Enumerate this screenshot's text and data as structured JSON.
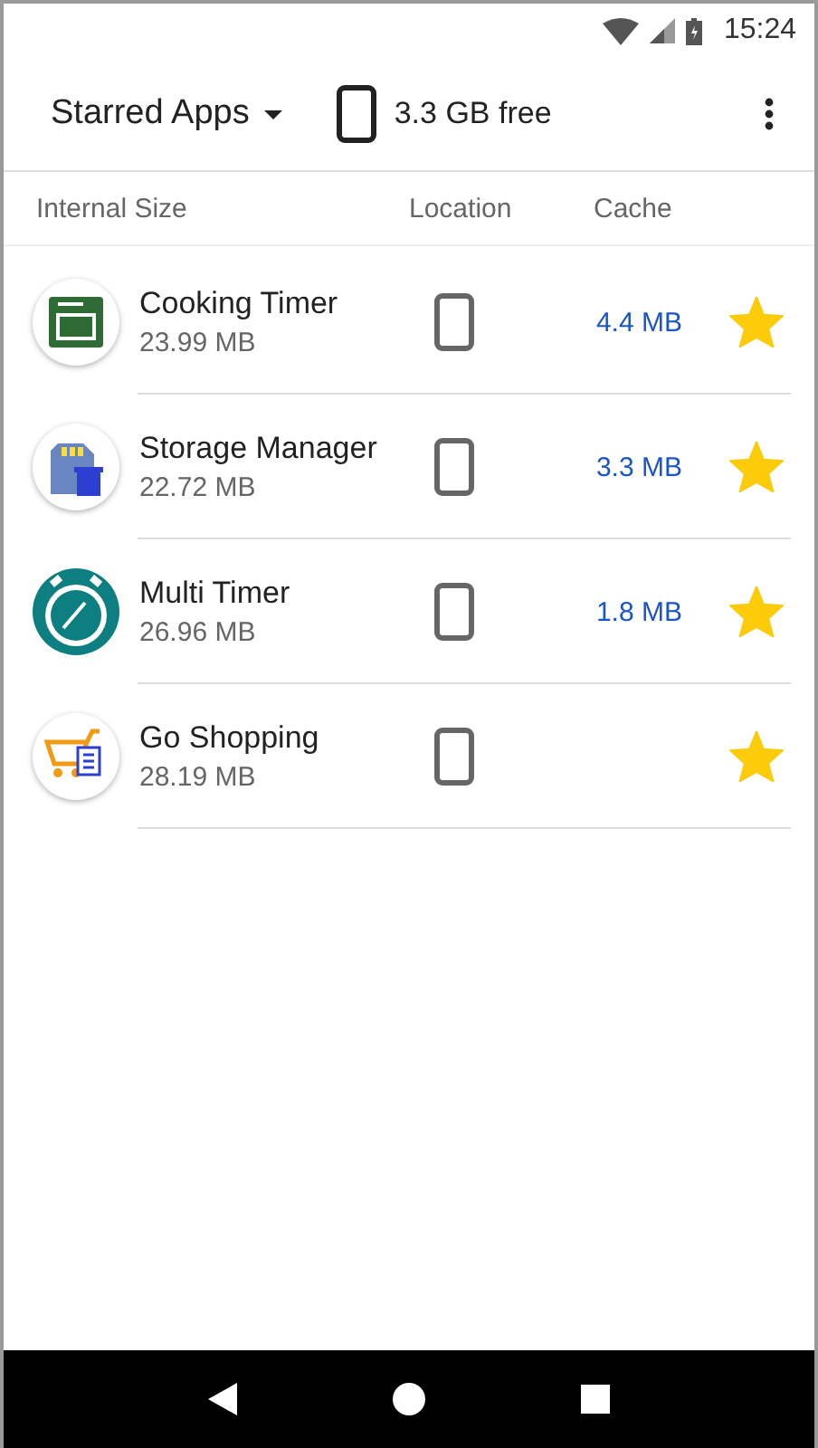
{
  "status_bar": {
    "time": "15:24"
  },
  "toolbar": {
    "filter": "Starred Apps",
    "storage": "3.3 GB free"
  },
  "columns": [
    "Internal Size",
    "Location",
    "Cache"
  ],
  "apps": [
    {
      "kind": "oven",
      "name": "Cooking Timer",
      "size": "23.99 MB",
      "cache": "4.4 MB",
      "starred": true
    },
    {
      "kind": "storage",
      "name": "Storage Manager",
      "size": "22.72 MB",
      "cache": "3.3 MB",
      "starred": true
    },
    {
      "kind": "timer",
      "name": "Multi Timer",
      "size": "26.96 MB",
      "cache": "1.8 MB",
      "starred": true
    },
    {
      "kind": "cart",
      "name": "Go Shopping",
      "size": "28.19 MB",
      "starred": true
    }
  ]
}
